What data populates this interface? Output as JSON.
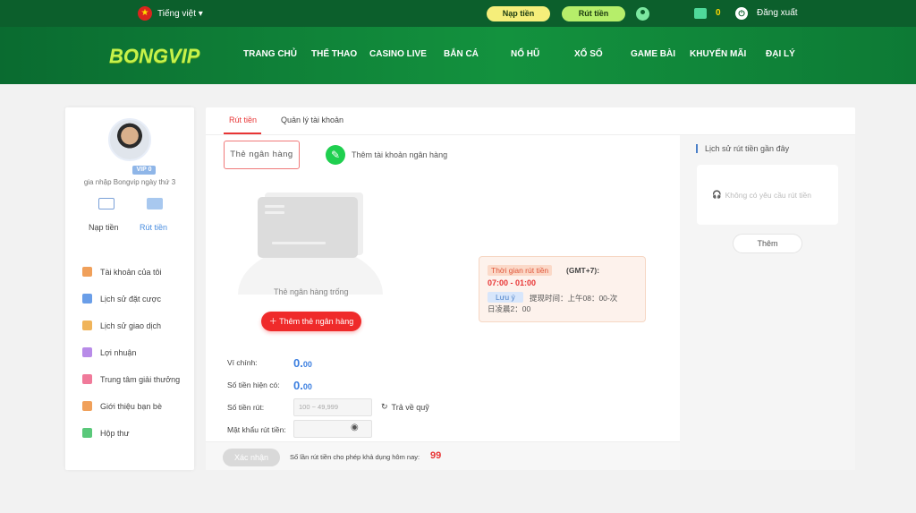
{
  "topbar": {
    "language": "Tiếng việt ▾",
    "nap_button": "Nạp tiền",
    "rut_button": "Rút tiền",
    "balance": "0",
    "logout": "Đăng xuất"
  },
  "header": {
    "logo": "BONGVIP",
    "nav": [
      "TRANG CHỦ",
      "THỂ THAO",
      "CASINO LIVE",
      "BẮN CÁ",
      "NỔ HŨ",
      "XỔ SỐ",
      "GAME BÀI",
      "KHUYẾN MÃI",
      "ĐẠI LÝ"
    ]
  },
  "sidebar": {
    "vip": "VIP 0",
    "join_text": "gia nhập Bongvip ngày thứ 3",
    "nap_label": "Nạp tiền",
    "rut_label": "Rút tiền",
    "menu": [
      {
        "label": "Tài khoản của tôi",
        "color": "#f0a05a"
      },
      {
        "label": "Lịch sử đặt cược",
        "color": "#6a9ee8"
      },
      {
        "label": "Lịch sử giao dịch",
        "color": "#f0b45a"
      },
      {
        "label": "Lợi nhuận",
        "color": "#b88be8"
      },
      {
        "label": "Trung tâm giải thưởng",
        "color": "#f07a9a"
      },
      {
        "label": "Giới thiệu bạn bè",
        "color": "#f0a05a"
      },
      {
        "label": "Hộp thư",
        "color": "#5ac87a"
      }
    ]
  },
  "main": {
    "tabs": [
      "Rút tiền",
      "Quản lý tài khoản"
    ],
    "bank_card_button": "Thẻ ngân hàng",
    "add_bank_account": "Thêm tài khoản ngân hàng",
    "empty_text": "Thẻ ngân hàng trống",
    "add_card_button": "Thêm thẻ ngân hàng",
    "time_box": {
      "label": "Thời gian rút tiền",
      "gmt": "(GMT+7):",
      "time": "07:00 - 01:00",
      "note_label": "Lưu ý",
      "note_text": "提现时间：上午08：00-次",
      "note_text2": "日凌晨2：00"
    },
    "form": {
      "main_wallet_label": "Ví chính:",
      "main_wallet_value": "0.",
      "main_wallet_decimal": "00",
      "available_label": "Số tiền hiện có:",
      "available_value": "0.",
      "available_decimal": "00",
      "amount_label": "Số tiền rút:",
      "amount_placeholder": "100 ~ 49,999",
      "refresh_label": "Trả về quỹ",
      "password_label": "Mật khẩu rút tiền:"
    },
    "confirm_button": "Xác nhận",
    "limit_text": "Số lần rút tiền cho phép khả dụng hôm nay:",
    "limit_count": "99"
  },
  "history": {
    "title": "Lịch sử rút tiền gần đây",
    "empty": "Không có yêu cầu rút tiền",
    "more_button": "Thêm"
  }
}
